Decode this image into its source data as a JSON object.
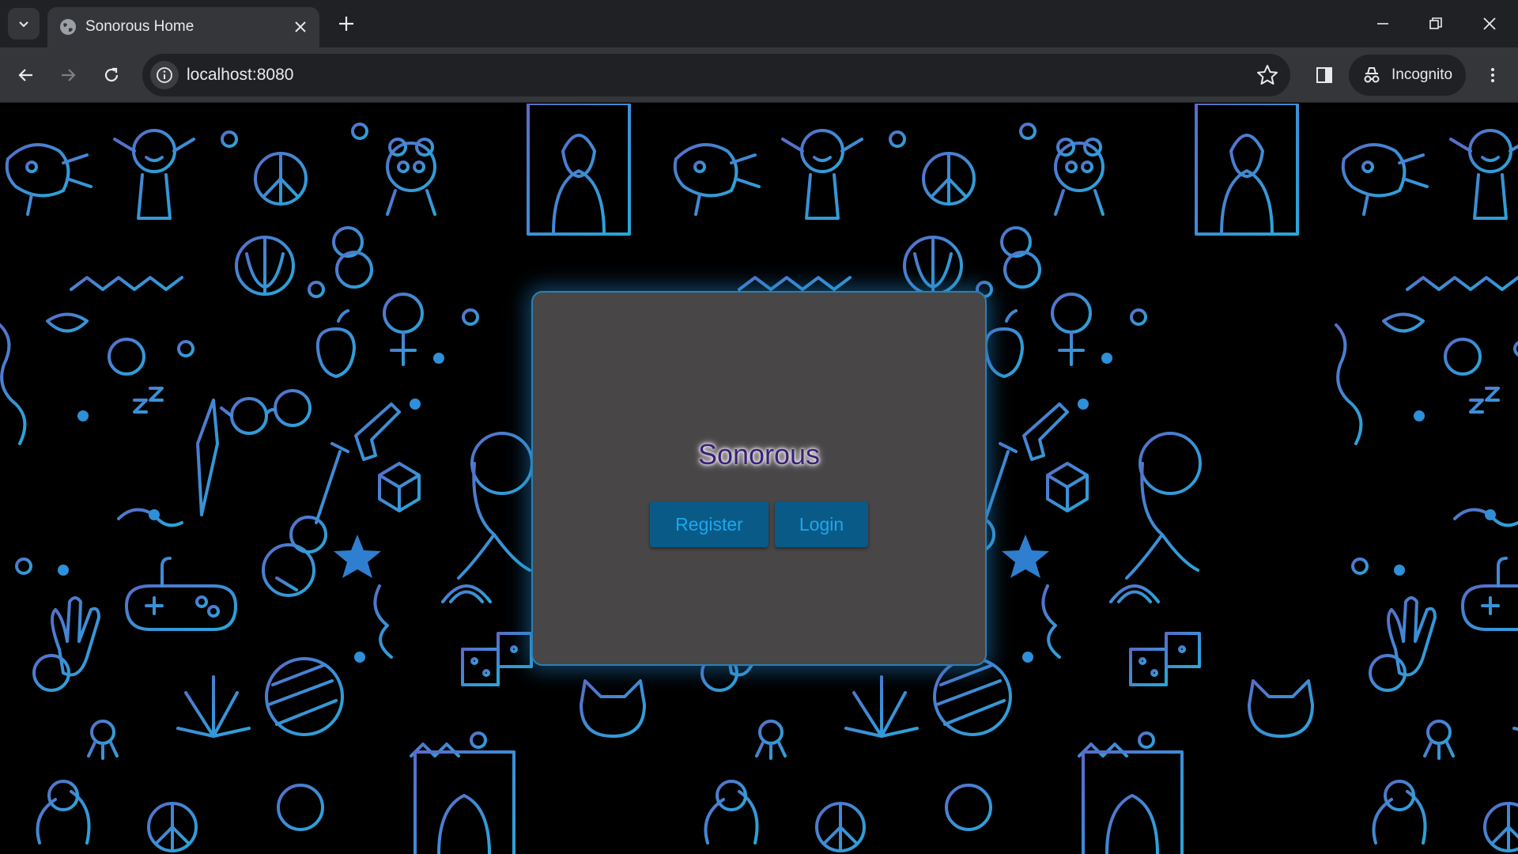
{
  "browser": {
    "tab_title": "Sonorous Home",
    "url": "localhost:8080",
    "incognito_label": "Incognito",
    "icons": [
      "tab-search-icon",
      "globe-icon",
      "close-icon",
      "plus-icon",
      "minimize-icon",
      "restore-icon",
      "close-window-icon",
      "back-arrow-icon",
      "forward-arrow-icon",
      "reload-icon",
      "site-info-icon",
      "star-icon",
      "side-panel-icon",
      "incognito-icon",
      "kebab-menu-icon"
    ]
  },
  "page": {
    "title": "Sonorous",
    "register_label": "Register",
    "login_label": "Login",
    "colors": {
      "background": "#000000",
      "doodle_blue": "#2f8fd8",
      "doodle_purple": "#6b5bb8",
      "card": "#484647",
      "card_glow": "#1f7cbe",
      "button": "#0a5a87",
      "button_text": "#1aa8f0",
      "title_text": "#3b1f78"
    }
  }
}
